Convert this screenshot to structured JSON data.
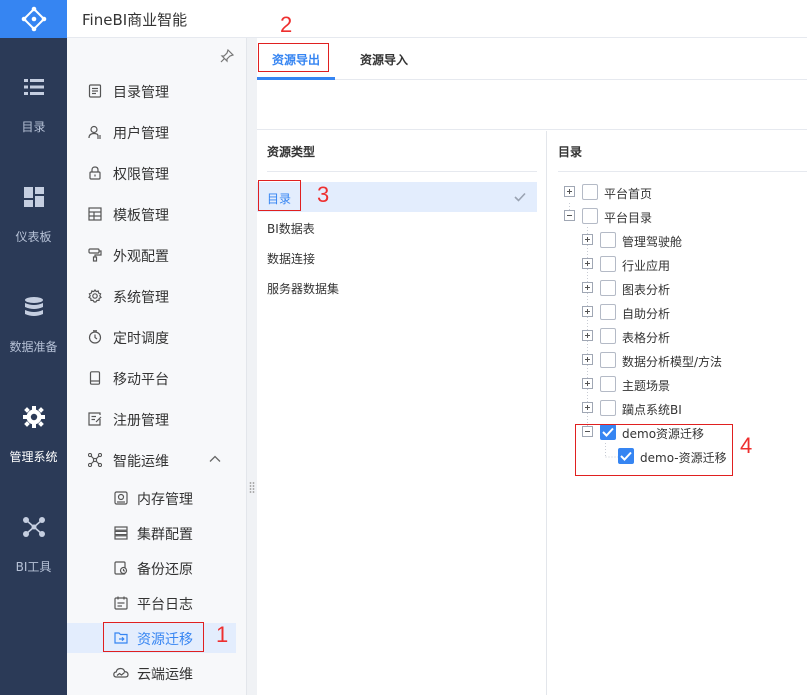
{
  "app": {
    "title": "FineBI商业智能"
  },
  "rail": [
    {
      "label": "目录",
      "icon": "list-icon"
    },
    {
      "label": "仪表板",
      "icon": "dashboard-icon"
    },
    {
      "label": "数据准备",
      "icon": "database-icon"
    },
    {
      "label": "管理系统",
      "icon": "gear-icon",
      "active": true
    },
    {
      "label": "BI工具",
      "icon": "network-icon"
    }
  ],
  "sidebar": {
    "items": [
      {
        "label": "目录管理",
        "icon": "catalog-icon"
      },
      {
        "label": "用户管理",
        "icon": "user-icon"
      },
      {
        "label": "权限管理",
        "icon": "lock-icon"
      },
      {
        "label": "模板管理",
        "icon": "template-icon"
      },
      {
        "label": "外观配置",
        "icon": "paint-icon"
      },
      {
        "label": "系统管理",
        "icon": "settings-icon"
      },
      {
        "label": "定时调度",
        "icon": "clock-icon"
      },
      {
        "label": "移动平台",
        "icon": "mobile-icon"
      },
      {
        "label": "注册管理",
        "icon": "register-icon"
      },
      {
        "label": "智能运维",
        "icon": "ops-icon"
      }
    ],
    "subitems": [
      {
        "label": "内存管理",
        "icon": "memory-icon"
      },
      {
        "label": "集群配置",
        "icon": "cluster-icon"
      },
      {
        "label": "备份还原",
        "icon": "backup-icon"
      },
      {
        "label": "平台日志",
        "icon": "log-icon"
      },
      {
        "label": "资源迁移",
        "icon": "migrate-icon",
        "selected": true
      },
      {
        "label": "云端运维",
        "icon": "cloud-icon"
      }
    ]
  },
  "tabs": [
    {
      "label": "资源导出",
      "active": true
    },
    {
      "label": "资源导入"
    }
  ],
  "left_panel": {
    "header": "资源类型",
    "items": [
      "目录",
      "BI数据表",
      "数据连接",
      "服务器数据集"
    ]
  },
  "right_panel": {
    "header": "目录",
    "tree": [
      {
        "label": "平台首页",
        "level": 0,
        "expander": "plus",
        "checked": false
      },
      {
        "label": "平台目录",
        "level": 0,
        "expander": "minus",
        "checked": false
      },
      {
        "label": "管理驾驶舱",
        "level": 1,
        "expander": "plus",
        "checked": false
      },
      {
        "label": "行业应用",
        "level": 1,
        "expander": "plus",
        "checked": false
      },
      {
        "label": "图表分析",
        "level": 1,
        "expander": "plus",
        "checked": false
      },
      {
        "label": "自助分析",
        "level": 1,
        "expander": "plus",
        "checked": false
      },
      {
        "label": "表格分析",
        "level": 1,
        "expander": "plus",
        "checked": false
      },
      {
        "label": "数据分析模型/方法",
        "level": 1,
        "expander": "plus",
        "checked": false
      },
      {
        "label": "主题场景",
        "level": 1,
        "expander": "plus",
        "checked": false
      },
      {
        "label": "躏点系统BI",
        "level": 1,
        "expander": "plus",
        "checked": false
      },
      {
        "label": "demo资源迁移",
        "level": 1,
        "expander": "minus",
        "checked": true
      },
      {
        "label": "demo-资源迁移",
        "level": 2,
        "expander": "none",
        "checked": true
      }
    ]
  },
  "annotations": [
    "1",
    "2",
    "3",
    "4"
  ],
  "colors": {
    "accent": "#3685f2",
    "rail": "#2b3a57",
    "annotation": "#e02020"
  }
}
